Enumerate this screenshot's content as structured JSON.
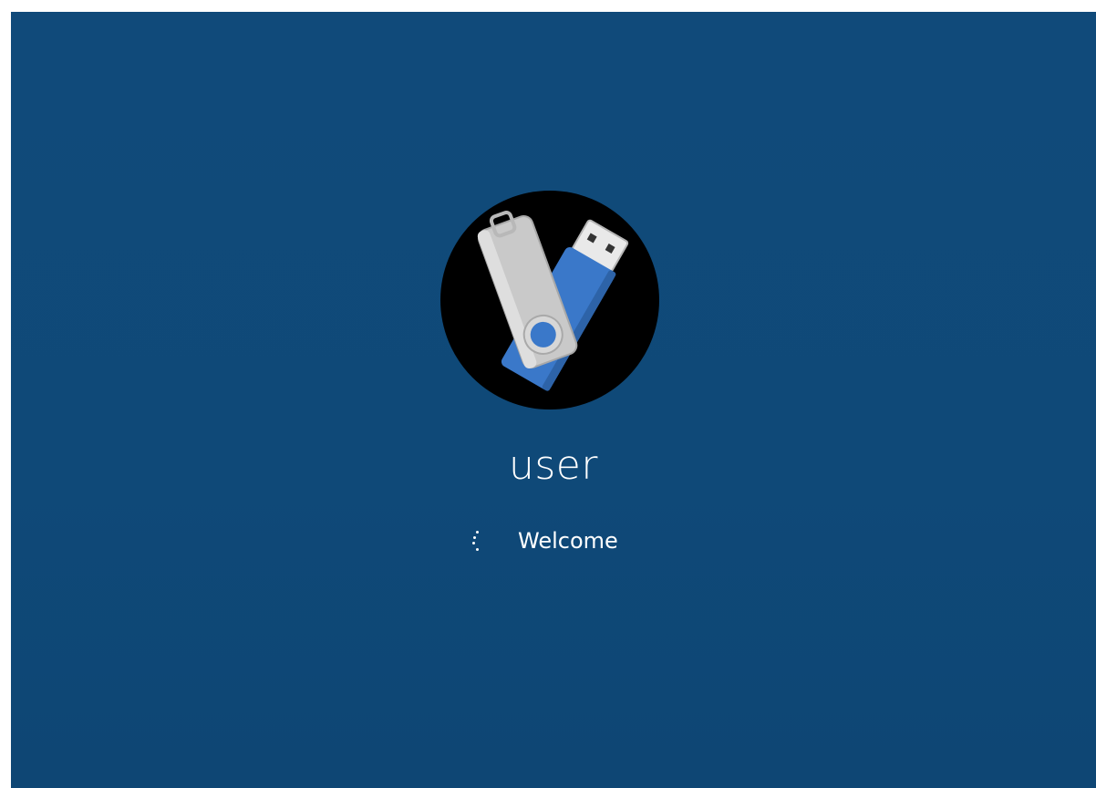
{
  "login": {
    "username": "user",
    "status_text": "Welcome"
  },
  "avatar": {
    "icon": "usb-flash-drive-icon",
    "background_color": "#000000"
  },
  "spinner": {
    "icon": "loading-spinner-icon"
  },
  "colors": {
    "background": "#104a7a",
    "text": "#ffffff",
    "usb_blue": "#3a78c9",
    "usb_silver": "#c4c4c4"
  }
}
